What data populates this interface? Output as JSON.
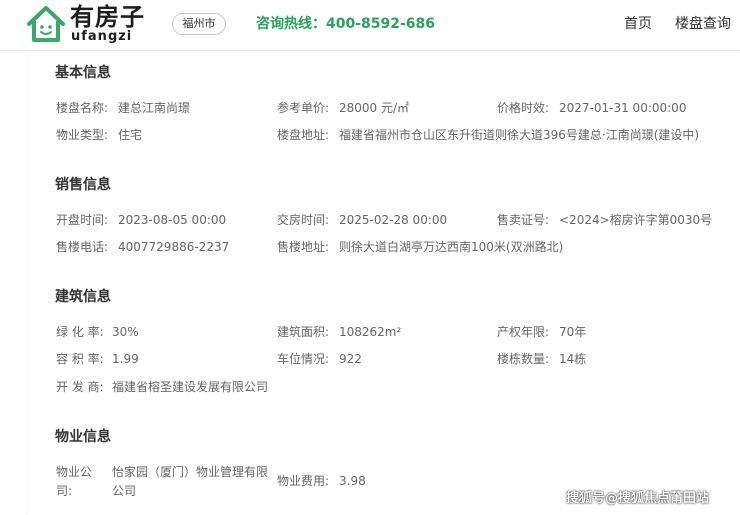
{
  "header": {
    "logo_cn": "有房子",
    "logo_en": "ufangzi",
    "city": "福州市",
    "hotline": "咨询热线：400-8592-686",
    "nav": [
      "首页",
      "楼盘查询"
    ]
  },
  "sections": {
    "basic": {
      "title": "基本信息",
      "name_label": "楼盘名称:",
      "name": "建总江南尚璟",
      "price_label": "参考单价:",
      "price": "28000 元/㎡",
      "valid_label": "价格时效:",
      "valid": "2027-01-31 00:00:00",
      "type_label": "物业类型:",
      "type": "住宅",
      "address_label": "楼盘地址:",
      "address": "福建省福州市仓山区东升街道则徐大道396号建总·江南尚璟(建设中)"
    },
    "sales": {
      "title": "销售信息",
      "open_label": "开盘时间:",
      "open": "2023-08-05 00:00",
      "deliver_label": "交房时间:",
      "deliver": "2025-02-28 00:00",
      "permit_label": "售卖证号:",
      "permit": "<2024>榕房许字第0030号",
      "phone_label": "售楼电话:",
      "phone": "4007729886-2237",
      "sales_addr_label": "售楼地址:",
      "sales_addr": "则徐大道白湖亭万达西南100米(双洲路北)"
    },
    "building": {
      "title": "建筑信息",
      "green_label": "绿 化 率:",
      "green": "30%",
      "area_label": "建筑面积:",
      "area": "108262m²",
      "term_label": "产权年限:",
      "term": "70年",
      "plot_label": "容 积 率:",
      "plot": "1.99",
      "parking_label": "车位情况:",
      "parking": "922",
      "count_label": "楼栋数量:",
      "count": "14栋",
      "dev_label": "开 发 商:",
      "dev": "福建省榕圣建设发展有限公司"
    },
    "property": {
      "title": "物业信息",
      "company_label": "物业公司:",
      "company": "怡家园（厦门）物业管理有限公司",
      "fee_label": "物业费用:",
      "fee": "3.98"
    }
  },
  "watermark": "搜狐号@搜狐焦点莆田站",
  "colors": {
    "accent": "#27a35a",
    "logo_green": "#3aa86b"
  }
}
